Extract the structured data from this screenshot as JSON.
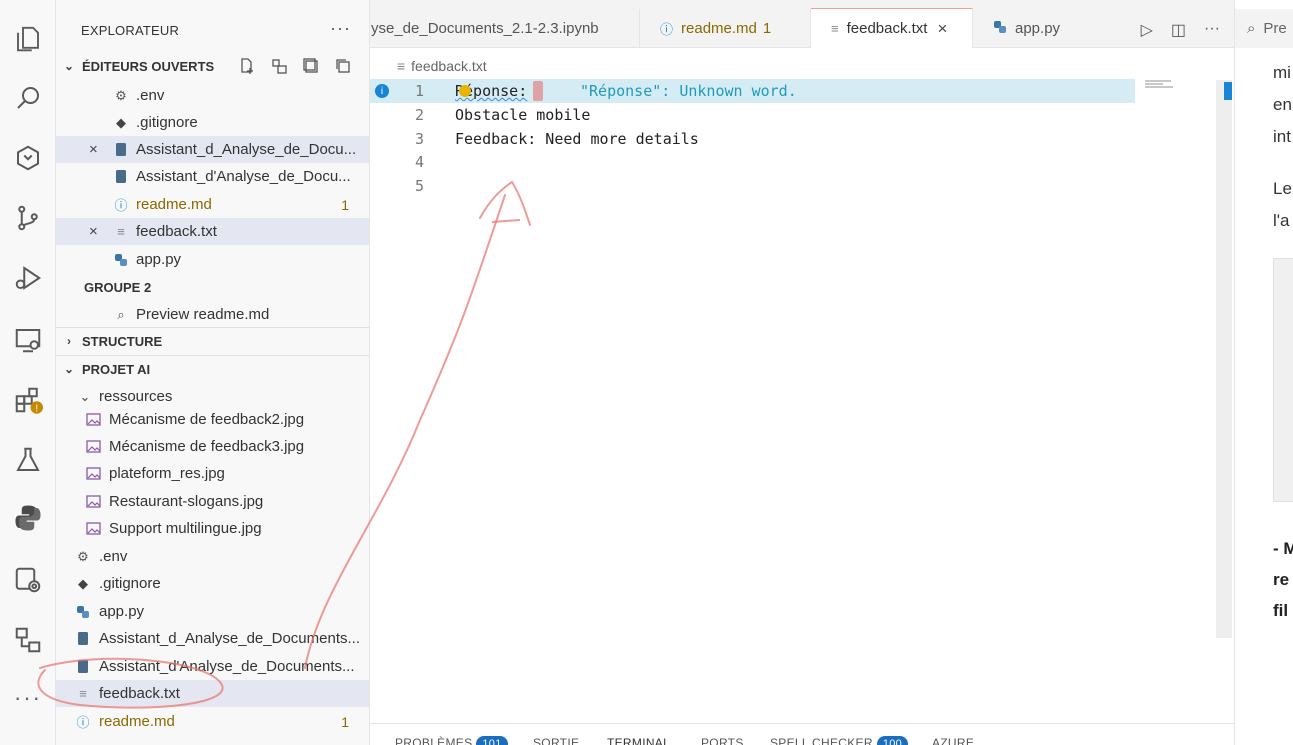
{
  "activity_bar": {
    "items": [
      {
        "name": "explorer",
        "icon": "files-icon"
      },
      {
        "name": "search",
        "icon": "search-icon"
      },
      {
        "name": "git-graph",
        "icon": "git-lens-icon"
      },
      {
        "name": "source-control",
        "icon": "source-control-icon"
      },
      {
        "name": "run-debug",
        "icon": "run-debug-icon"
      },
      {
        "name": "remote-explorer",
        "icon": "remote-explorer-icon"
      },
      {
        "name": "extensions",
        "icon": "extensions-icon"
      },
      {
        "name": "testing",
        "icon": "flask-icon"
      },
      {
        "name": "python",
        "icon": "python-icon"
      },
      {
        "name": "copilot-settings",
        "icon": "copilot-gear-icon"
      },
      {
        "name": "workflow",
        "icon": "workflow-icon"
      },
      {
        "name": "more",
        "icon": "ellipsis-icon"
      }
    ]
  },
  "sidebar": {
    "title": "EXPLORATEUR",
    "more": "···",
    "open_editors": {
      "header": "ÉDITEURS OUVERTS",
      "items": [
        {
          "label": ".env",
          "icon": "gear-icon",
          "close": "",
          "count": "",
          "selected": false
        },
        {
          "label": ".gitignore",
          "icon": "git-icon",
          "close": "",
          "count": "",
          "selected": false
        },
        {
          "label": "Assistant_d_Analyse_de_Docu...",
          "icon": "notebook-icon",
          "close": "×",
          "count": "",
          "selected": true
        },
        {
          "label": "Assistant_d'Analyse_de_Docu...",
          "icon": "notebook-icon",
          "close": "",
          "count": "",
          "selected": false
        },
        {
          "label": "readme.md",
          "icon": "info-icon",
          "close": "",
          "count": "1",
          "selected": false
        },
        {
          "label": "feedback.txt",
          "icon": "text-file-icon",
          "close": "×",
          "count": "",
          "selected": true
        },
        {
          "label": "app.py",
          "icon": "python-icon",
          "close": "",
          "count": "",
          "selected": false
        }
      ],
      "group2_label": "GROUPE 2",
      "group2_items": [
        {
          "label": "Preview readme.md",
          "icon": "preview-icon"
        }
      ]
    },
    "structure": {
      "header": "STRUCTURE"
    },
    "project": {
      "header": "PROJET AI",
      "folder": "ressources",
      "folder_items": [
        {
          "label": "Mécanisme de feedback2.jpg",
          "icon": "image-icon"
        },
        {
          "label": "Mécanisme de feedback3.jpg",
          "icon": "image-icon"
        },
        {
          "label": "plateform_res.jpg",
          "icon": "image-icon"
        },
        {
          "label": "Restaurant-slogans.jpg",
          "icon": "image-icon"
        },
        {
          "label": "Support multilingue.jpg",
          "icon": "image-icon"
        }
      ],
      "items": [
        {
          "label": ".env",
          "icon": "gear-icon",
          "count": ""
        },
        {
          "label": ".gitignore",
          "icon": "git-icon",
          "count": ""
        },
        {
          "label": "app.py",
          "icon": "python-icon",
          "count": ""
        },
        {
          "label": "Assistant_d_Analyse_de_Documents...",
          "icon": "notebook-icon",
          "count": ""
        },
        {
          "label": "Assistant_d'Analyse_de_Documents...",
          "icon": "notebook-icon",
          "count": ""
        },
        {
          "label": "feedback.txt",
          "icon": "text-file-icon",
          "count": ""
        },
        {
          "label": "readme.md",
          "icon": "info-icon",
          "count": "1"
        }
      ]
    }
  },
  "tabs": [
    {
      "label": "yse_de_Documents_2.1-2.3.ipynb",
      "icon": "",
      "badge": "",
      "active": false
    },
    {
      "label": "readme.md",
      "icon": "info-icon",
      "badge": "1",
      "active": false
    },
    {
      "label": "feedback.txt",
      "icon": "text-file-icon",
      "badge": "",
      "active": true,
      "close": "×"
    },
    {
      "label": "app.py",
      "icon": "python-icon",
      "badge": "",
      "active": false
    }
  ],
  "tab_tools": {
    "run": "▷",
    "split": "◫",
    "more": "···"
  },
  "breadcrumb": {
    "file": "feedback.txt"
  },
  "editor": {
    "lines": [
      {
        "n": "1",
        "text": "Réponse:",
        "diagnostic": "\"Réponse\": Unknown word."
      },
      {
        "n": "2",
        "text": "Obstacle mobile"
      },
      {
        "n": "3",
        "text": "Feedback: Need more details"
      },
      {
        "n": "4",
        "text": ""
      },
      {
        "n": "5",
        "text": ""
      }
    ]
  },
  "panel": {
    "tabs": [
      {
        "label": "PROBLÈMES",
        "badge": "101"
      },
      {
        "label": "SORTIE",
        "badge": ""
      },
      {
        "label": "TERMINAL",
        "badge": ""
      },
      {
        "label": "PORTS",
        "badge": ""
      },
      {
        "label": "SPELL CHECKER",
        "badge": "100"
      },
      {
        "label": "AZURE",
        "badge": ""
      }
    ]
  },
  "preview": {
    "tab_label": "Pre",
    "text_lines": [
      "mi",
      "en",
      "int",
      "Le",
      "l'a"
    ],
    "bold_lines": [
      "- M",
      "re",
      "fil"
    ]
  },
  "colors": {
    "accent": "#1a85d4",
    "annotation": "#e8706a",
    "selected_row": "#e4e6f1",
    "highlight_line": "#d6ecf5"
  }
}
